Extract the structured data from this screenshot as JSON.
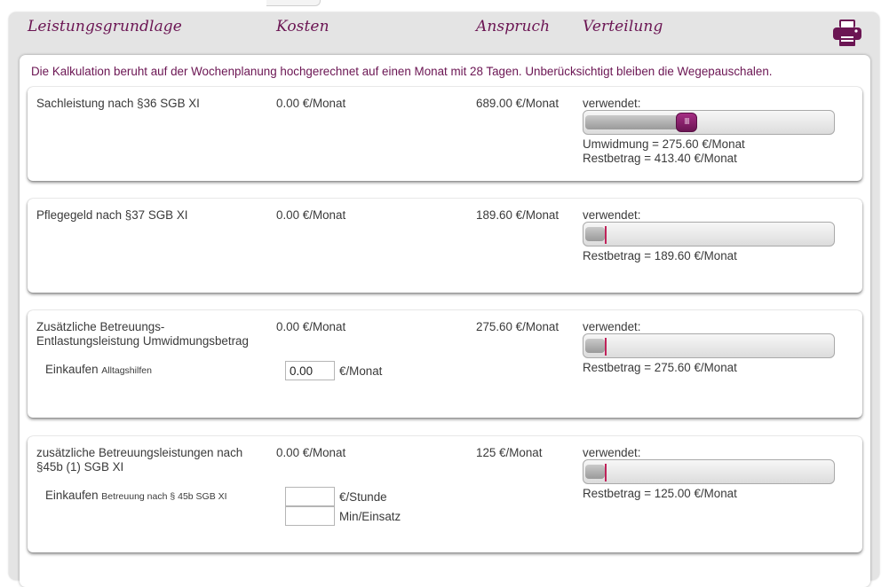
{
  "header": {
    "col_basis": "Leistungsgrundlage",
    "col_costs": "Kosten",
    "col_claim": "Anspruch",
    "col_distribution": "Verteilung"
  },
  "info_text": "Die Kalkulation beruht auf der Wochenplanung hochgerechnet auf einen Monat mit 28 Tagen. Unberücksichtigt bleiben die Wegepauschalen.",
  "colors": {
    "accent": "#6b1553",
    "marker": "#c0225a"
  },
  "icons": {
    "print": "printer-icon"
  },
  "cards": [
    {
      "title": "Sachleistung nach §36 SGB XI",
      "cost": "0.00 €/Monat",
      "claim": "689.00 €/Monat",
      "used_label": "verwendet:",
      "slider_fraction": 0.4,
      "conversion": "Umwidmung = 275.60 €/Monat",
      "remaining": "Restbetrag = 413.40 €/Monat"
    },
    {
      "title": "Pflegegeld nach §37 SGB XI",
      "cost": "0.00 €/Monat",
      "claim": "189.60 €/Monat",
      "used_label": "verwendet:",
      "slider_fraction": 0.0,
      "remaining": "Restbetrag = 189.60 €/Monat"
    },
    {
      "title_line1": "Zusätzliche Betreuungs-",
      "title_line2": "Entlastungsleistung Umwidmungsbetrag",
      "cost": "0.00 €/Monat",
      "claim": "275.60 €/Monat",
      "used_label": "verwendet:",
      "slider_fraction": 0.0,
      "remaining": "Restbetrag = 275.60 €/Monat",
      "item_label": "Einkaufen",
      "item_sub": "Alltagshilfen",
      "item_value": "0.00",
      "item_unit": "€/Monat"
    },
    {
      "title_line1": "zusätzliche Betreuungsleistungen nach",
      "title_line2": "§45b (1) SGB XI",
      "cost": "0.00 €/Monat",
      "claim": "125 €/Monat",
      "used_label": "verwendet:",
      "slider_fraction": 0.0,
      "remaining": "Restbetrag = 125.00 €/Monat",
      "item_label": "Einkaufen",
      "item_sub": "Betreuung nach § 45b SGB XI",
      "input1_value": "",
      "input1_unit": "€/Stunde",
      "input2_value": "",
      "input2_unit": "Min/Einsatz"
    }
  ]
}
